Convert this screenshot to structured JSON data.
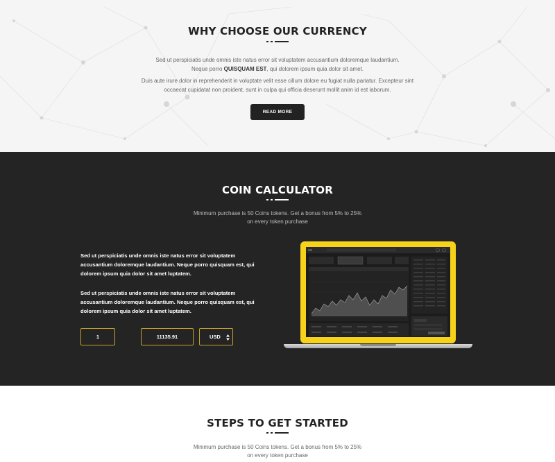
{
  "why": {
    "title": "WHY CHOOSE OUR CURRENCY",
    "p1_line1": "Sed ut perspiciatis unde omnis iste natus error sit voluptatem accusantium doloremque laudantium.",
    "p1_line2_pre": "Neque porro ",
    "p1_line2_bold": "QUISQUAM EST",
    "p1_line2_post": ", qui dolorem ipsum quia dolor sit amet.",
    "p2_line1": "Duis aute irure dolor in reprehenderit in voluptate velit esse cillum dolore eu fugiat nulla pariatur. Excepteur sint",
    "p2_line2": "occaecat cupidatat non proident, sunt in culpa qui officia deserunt mollit anim id est laborum.",
    "button": "READ MORE"
  },
  "calculator": {
    "title": "COIN CALCULATOR",
    "subtitle_line1": "Minimum purchase is 50 Coins tokens. Get a bonus from 5% to 25%",
    "subtitle_line2": "on every token purchase",
    "text1_line1": "Sed ut perspiciatis unde omnis iste natus error sit voluptatem",
    "text1_line2": "accusantium doloremque laudantium. Neque porro quisquam est, qui",
    "text1_line3": "dolorem ipsum quia dolor sit amet luptatem.",
    "text2_line1": "Sed ut perspiciatis unde omnis iste natus error sit voluptatem",
    "text2_line2": "accusantium doloremque laudantium. Neque porro quisquam est, qui",
    "text2_line3": "dolorem ipsum quia dolor sit amet luptatem.",
    "amount": "1",
    "result": "11135.91",
    "currency": "USD",
    "currency_icon": "updown-arrows-icon"
  },
  "steps": {
    "title": "STEPS TO GET STARTED",
    "subtitle_line1": "Minimum purchase is 50 Coins tokens. Get a bonus from 5% to 25%",
    "subtitle_line2": "on every token purchase"
  },
  "colors": {
    "accent": "#f6d31a",
    "dark": "#242424",
    "dash_dark": "#222222",
    "dash_light": "#ffffff"
  }
}
